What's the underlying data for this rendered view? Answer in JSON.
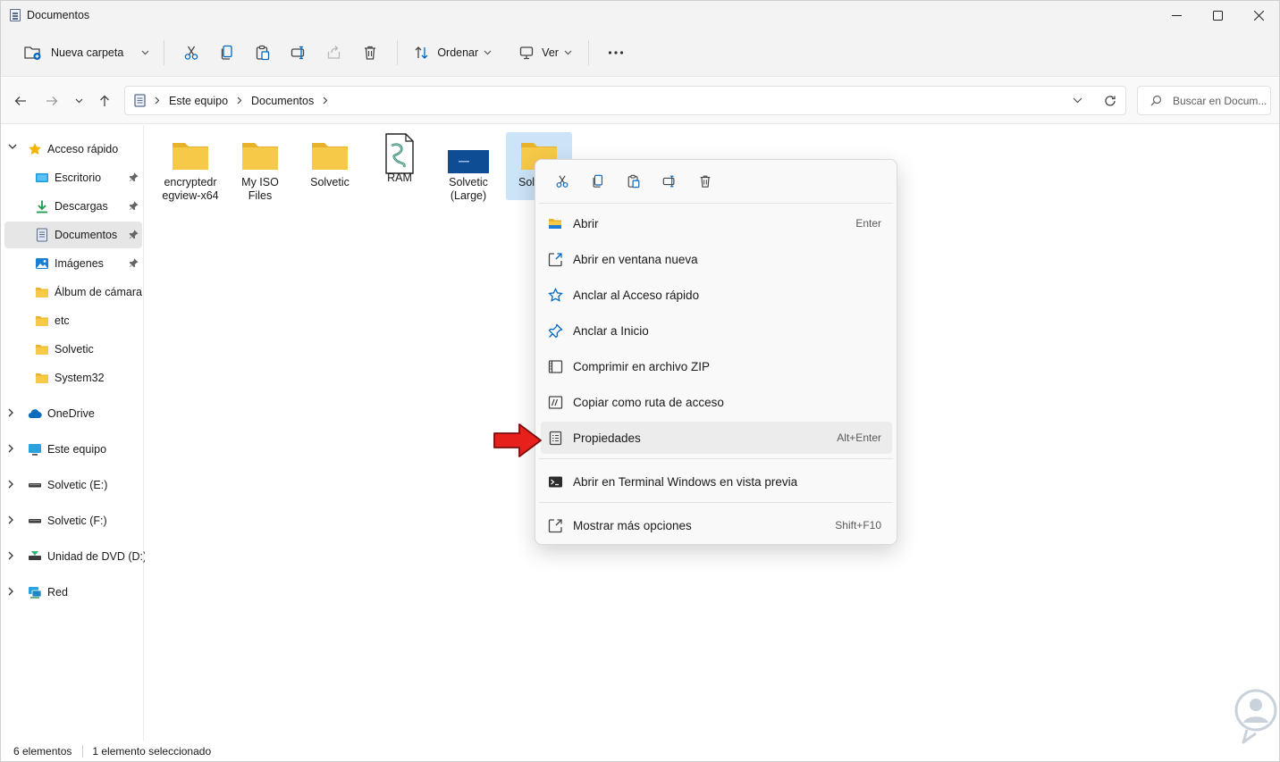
{
  "window": {
    "title": "Documentos"
  },
  "toolbar": {
    "new_folder": "Nueva carpeta",
    "sort": "Ordenar",
    "view": "Ver"
  },
  "address": {
    "crumbs": [
      "Este equipo",
      "Documentos"
    ],
    "search_placeholder": "Buscar en Docum..."
  },
  "sidebar": {
    "quick_access": "Acceso rápido",
    "items": [
      {
        "label": "Escritorio",
        "icon": "desktop-icon",
        "pinned": true
      },
      {
        "label": "Descargas",
        "icon": "download-icon",
        "pinned": true
      },
      {
        "label": "Documentos",
        "icon": "document-icon",
        "pinned": true,
        "selected": true
      },
      {
        "label": "Imágenes",
        "icon": "image-icon",
        "pinned": true
      },
      {
        "label": "Álbum de cámara",
        "icon": "folder-icon",
        "pinned": false
      },
      {
        "label": "etc",
        "icon": "folder-icon",
        "pinned": false
      },
      {
        "label": "Solvetic",
        "icon": "folder-icon",
        "pinned": false
      },
      {
        "label": "System32",
        "icon": "folder-icon",
        "pinned": false
      }
    ],
    "roots": [
      {
        "label": "OneDrive",
        "icon": "cloud-icon"
      },
      {
        "label": "Este equipo",
        "icon": "computer-icon"
      },
      {
        "label": "Solvetic (E:)",
        "icon": "drive-icon"
      },
      {
        "label": "Solvetic (F:)",
        "icon": "drive-icon"
      },
      {
        "label": "Unidad de DVD (D:)",
        "icon": "dvd-icon"
      },
      {
        "label": "Red",
        "icon": "network-icon"
      }
    ]
  },
  "files": [
    {
      "line1": "encryptedr",
      "line2": "egview-x64",
      "icon": "folder-icon"
    },
    {
      "line1": "My ISO",
      "line2": "Files",
      "icon": "folder-icon"
    },
    {
      "line1": "Solvetic",
      "line2": "",
      "icon": "folder-icon"
    },
    {
      "line1": "RAM",
      "line2": "",
      "icon": "script-file-icon"
    },
    {
      "line1": "Solvetic",
      "line2": "(Large)",
      "icon": "image-thumbnail-icon"
    },
    {
      "line1": "Sol",
      "line2": "",
      "icon": "folder-icon",
      "selected": true
    }
  ],
  "context_menu": {
    "items": [
      {
        "label": "Abrir",
        "shortcut": "Enter",
        "icon": "open-folder-icon"
      },
      {
        "label": "Abrir en ventana nueva",
        "shortcut": "",
        "icon": "new-window-icon"
      },
      {
        "label": "Anclar al Acceso rápido",
        "shortcut": "",
        "icon": "star-icon"
      },
      {
        "label": "Anclar a Inicio",
        "shortcut": "",
        "icon": "pin-icon"
      },
      {
        "label": "Comprimir en archivo ZIP",
        "shortcut": "",
        "icon": "zip-icon"
      },
      {
        "label": "Copiar como ruta de acceso",
        "shortcut": "",
        "icon": "path-icon"
      },
      {
        "label": "Propiedades",
        "shortcut": "Alt+Enter",
        "icon": "properties-icon",
        "highlighted": true
      },
      {
        "label": "Abrir en Terminal Windows en vista previa",
        "shortcut": "",
        "icon": "terminal-icon"
      },
      {
        "label": "Mostrar más opciones",
        "shortcut": "Shift+F10",
        "icon": "more-options-icon"
      }
    ]
  },
  "status": {
    "count": "6 elementos",
    "selection": "1 elemento seleccionado"
  },
  "colors": {
    "accent": "#0067c0",
    "folder": "#f7c948",
    "selection": "#cce4f7",
    "arrow": "#e8201c"
  }
}
